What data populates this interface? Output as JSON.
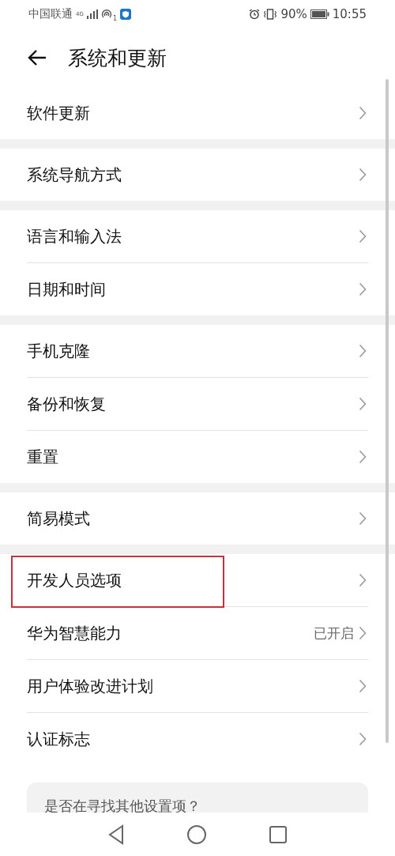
{
  "status_bar": {
    "carrier": "中国联通",
    "network": "4G",
    "hotspot_count": "1",
    "battery": "90%",
    "time": "10:55"
  },
  "header": {
    "title": "系统和更新"
  },
  "groups": [
    {
      "items": [
        {
          "label": "软件更新",
          "highlighted": false
        }
      ]
    },
    {
      "items": [
        {
          "label": "系统导航方式",
          "highlighted": false
        }
      ]
    },
    {
      "items": [
        {
          "label": "语言和输入法",
          "highlighted": false
        },
        {
          "label": "日期和时间",
          "highlighted": false
        }
      ]
    },
    {
      "items": [
        {
          "label": "手机克隆",
          "highlighted": false
        },
        {
          "label": "备份和恢复",
          "highlighted": false
        },
        {
          "label": "重置",
          "highlighted": false
        }
      ]
    },
    {
      "items": [
        {
          "label": "简易模式",
          "highlighted": false
        }
      ]
    },
    {
      "items": [
        {
          "label": "开发人员选项",
          "highlighted": true
        },
        {
          "label": "华为智慧能力",
          "value": "已开启",
          "highlighted": false
        },
        {
          "label": "用户体验改进计划",
          "highlighted": false
        },
        {
          "label": "认证标志",
          "highlighted": false
        }
      ]
    }
  ],
  "suggestion_card": {
    "text": "是否在寻找其他设置项？"
  }
}
